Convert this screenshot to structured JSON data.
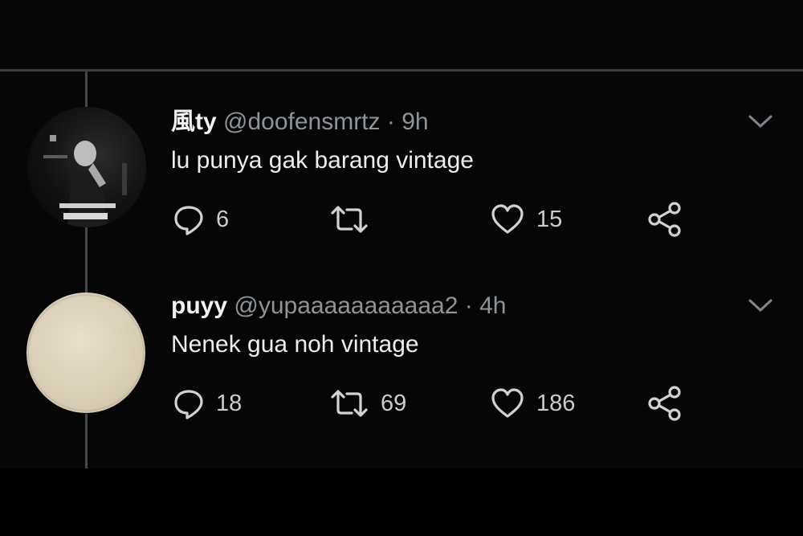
{
  "tweets": [
    {
      "display_name": "風ty",
      "handle": "@doofensmrtz",
      "separator": "·",
      "time": "9h",
      "text": "lu punya gak barang vintage",
      "replies": "6",
      "retweets": "",
      "likes": "15",
      "avatar_icon": "avatar-photo"
    },
    {
      "display_name": "puyy",
      "handle": "@yupaaaaaaaaaaa2",
      "separator": "·",
      "time": "4h",
      "text": "Nenek gua noh vintage",
      "replies": "18",
      "retweets": "69",
      "likes": "186",
      "avatar_icon": "avatar-photo"
    }
  ],
  "icons": {
    "reply": "reply-icon",
    "retweet": "retweet-icon",
    "like": "heart-icon",
    "share": "share-icon",
    "menu": "chevron-down-icon"
  },
  "colors": {
    "background": "#060606",
    "text_primary": "#f2f2f2",
    "text_secondary": "#8e9499",
    "divider": "#3a3d40"
  }
}
